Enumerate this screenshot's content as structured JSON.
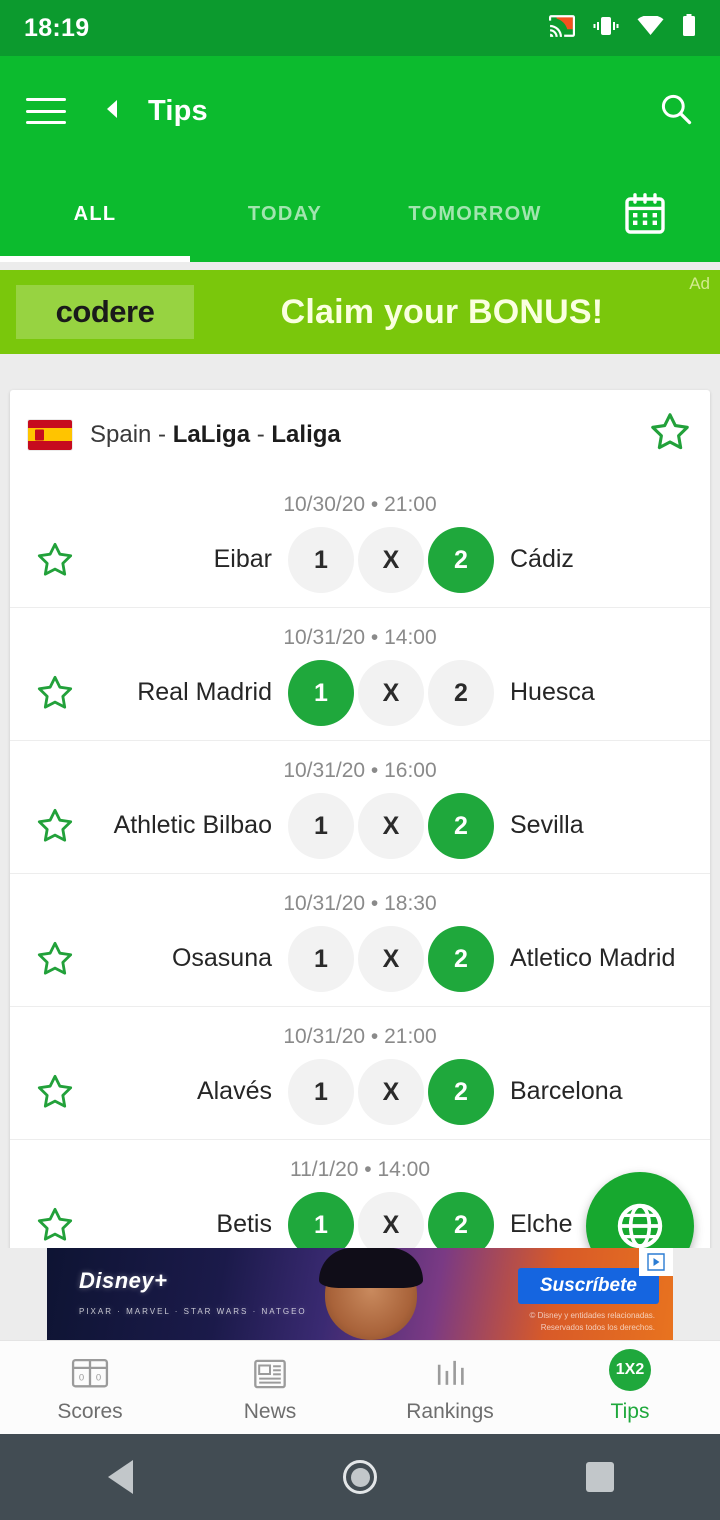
{
  "status_bar": {
    "time": "18:19",
    "icons": [
      "cast-icon",
      "vibrate-icon",
      "wifi-icon",
      "battery-icon"
    ]
  },
  "app_bar": {
    "title": "Tips",
    "menu_icon": "hamburger-icon",
    "back_icon": "back-arrow-icon",
    "search_icon": "search-icon"
  },
  "tabs": {
    "items": [
      {
        "label": "ALL",
        "active": true
      },
      {
        "label": "TODAY",
        "active": false
      },
      {
        "label": "TOMORROW",
        "active": false
      }
    ],
    "calendar_icon": "calendar-icon"
  },
  "top_ad": {
    "brand": "codere",
    "headline": "Claim your BONUS!",
    "tag": "Ad",
    "bg_color": "#7AC70C"
  },
  "league": {
    "country": "Spain",
    "separator_1": " - ",
    "competition": "LaLiga",
    "separator_2": " - ",
    "stage": "Laliga",
    "flag": "spain-flag-icon",
    "favorite_icon": "star-outline-icon"
  },
  "matches": [
    {
      "datetime": "10/30/20 • 21:00",
      "home": "Eibar",
      "away": "Cádiz",
      "odds": [
        {
          "label": "1",
          "selected": false
        },
        {
          "label": "X",
          "selected": false
        },
        {
          "label": "2",
          "selected": true
        }
      ]
    },
    {
      "datetime": "10/31/20 • 14:00",
      "home": "Real Madrid",
      "away": "Huesca",
      "odds": [
        {
          "label": "1",
          "selected": true
        },
        {
          "label": "X",
          "selected": false
        },
        {
          "label": "2",
          "selected": false
        }
      ]
    },
    {
      "datetime": "10/31/20 • 16:00",
      "home": "Athletic Bilbao",
      "away": "Sevilla",
      "odds": [
        {
          "label": "1",
          "selected": false
        },
        {
          "label": "X",
          "selected": false
        },
        {
          "label": "2",
          "selected": true
        }
      ]
    },
    {
      "datetime": "10/31/20 • 18:30",
      "home": "Osasuna",
      "away": "Atletico Madrid",
      "odds": [
        {
          "label": "1",
          "selected": false
        },
        {
          "label": "X",
          "selected": false
        },
        {
          "label": "2",
          "selected": true
        }
      ]
    },
    {
      "datetime": "10/31/20 • 21:00",
      "home": "Alavés",
      "away": "Barcelona",
      "odds": [
        {
          "label": "1",
          "selected": false
        },
        {
          "label": "X",
          "selected": false
        },
        {
          "label": "2",
          "selected": true
        }
      ]
    },
    {
      "datetime": "11/1/20 • 14:00",
      "home": "Betis",
      "away": "Elche",
      "odds": [
        {
          "label": "1",
          "selected": true
        },
        {
          "label": "X",
          "selected": false
        },
        {
          "label": "2",
          "selected": true
        }
      ]
    }
  ],
  "fab": {
    "icon": "globe-icon",
    "color": "#17A82F"
  },
  "bottom_ad": {
    "brand": "Disney+",
    "brand_sub": "PIXAR · MARVEL · STAR WARS · NATGEO",
    "cta": "Suscríbete",
    "fine_print_1": "© Disney y entidades relacionadas.",
    "fine_print_2": "Reservados todos los derechos."
  },
  "bottom_nav": {
    "items": [
      {
        "label": "Scores",
        "icon": "scoreboard-icon",
        "active": false
      },
      {
        "label": "News",
        "icon": "newspaper-icon",
        "active": false
      },
      {
        "label": "Rankings",
        "icon": "bar-chart-icon",
        "active": false
      },
      {
        "label": "Tips",
        "icon": "1x2-badge-icon",
        "active": true,
        "badge": "1X2"
      }
    ]
  },
  "system_nav": {
    "back": "back-triangle-icon",
    "home": "home-circle-icon",
    "recents": "recents-square-icon"
  },
  "colors": {
    "status_green": "#0C9A2E",
    "brand_green": "#0CBB2E",
    "accent_green": "#1FA83C",
    "ad_lime": "#7AC70C",
    "pill_idle": "#F2F2F2"
  }
}
